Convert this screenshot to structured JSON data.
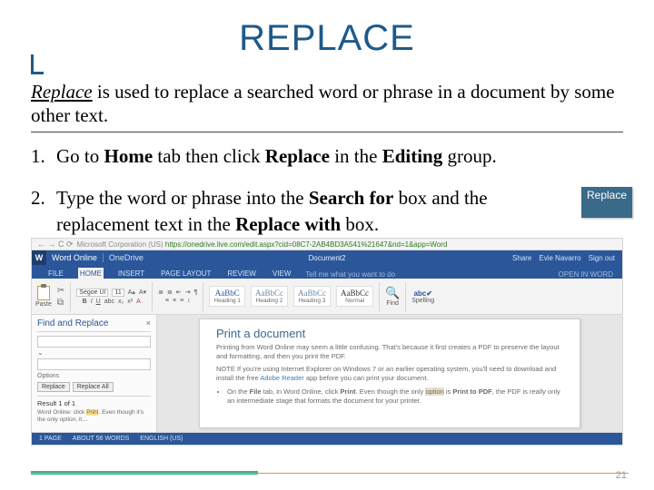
{
  "title": "REPLACE",
  "intro": {
    "lead": "Replace",
    "rest": " is used to replace a searched word or phrase in a document by some other text."
  },
  "steps": [
    {
      "num": "1.",
      "pre": "Go to ",
      "b1": "Home",
      "mid1": " tab then click ",
      "b2": "Replace",
      "mid2": " in the ",
      "b3": "Editing",
      "post": " group."
    },
    {
      "num": "2.",
      "pre": "Type the word or phrase into the ",
      "b1": "Search for",
      "mid1": " box and the replacement text in the ",
      "b2": "Replace with",
      "post": " box."
    }
  ],
  "badge": "Replace",
  "browser": {
    "nav": "← → C ⟳",
    "addr_prefix": "Microsoft Corporation (US) ",
    "addr": "https://onedrive.live.com/edit.aspx?cid=08C7-2AB4BD3A541%21647&nd=1&app=Word"
  },
  "word": {
    "logo": "W",
    "app": "Word Online",
    "location": "OneDrive",
    "doc": "Document2",
    "share": "Share",
    "user": "Evie Navarro",
    "signout": "Sign out",
    "tabs": [
      "FILE",
      "HOME",
      "INSERT",
      "PAGE LAYOUT",
      "REVIEW",
      "VIEW"
    ],
    "tell": "Tell me what you want to do",
    "open": "OPEN IN WORD",
    "ribbon": {
      "paste": "Paste",
      "font": "Segoe UI",
      "size": "11",
      "sty1": "AaBbC",
      "sty1l": "Heading 1",
      "sty2": "AaBbCc",
      "sty2l": "Heading 2",
      "sty3": "AaBbCc",
      "sty3l": "Heading 3",
      "sty4": "AaBbCc",
      "sty4l": "Normal",
      "find": "Find",
      "spell": "Spelling"
    },
    "pane": {
      "title": "Find and Replace",
      "options": "Options",
      "replace": "Replace",
      "replaceall": "Replace All",
      "result": "Result 1 of 1",
      "hint_a": "Word Online: click ",
      "hint_hl": "Print",
      "hint_b": ". Even though it's the only option, it…"
    },
    "document": {
      "heading": "Print a document",
      "p1": "Printing from Word Online may seem a little confusing. That's because it first creates a PDF to preserve the layout and formatting, and then you print the PDF.",
      "note_pre": "NOTE   If you're using Internet Explorer on Windows 7 or an earlier operating system, you'll need to download and install the free ",
      "note_link": "Adobe Reader",
      "note_post": " app before you can print your document.",
      "li1a": "On the ",
      "li1b": "File",
      "li1c": " tab, in Word Online, click ",
      "li1d": "Print",
      "li1e": ". Even though the only ",
      "li1_hl": "option",
      "li1f": " is ",
      "li1g": "Print to PDF",
      "li1h": ", the PDF is really only an intermediate stage that formats the document for your printer."
    },
    "status": {
      "page": "1 PAGE",
      "words": "ABOUT 56 WORDS",
      "lang": "ENGLISH (US)"
    }
  },
  "pagenum": "21"
}
